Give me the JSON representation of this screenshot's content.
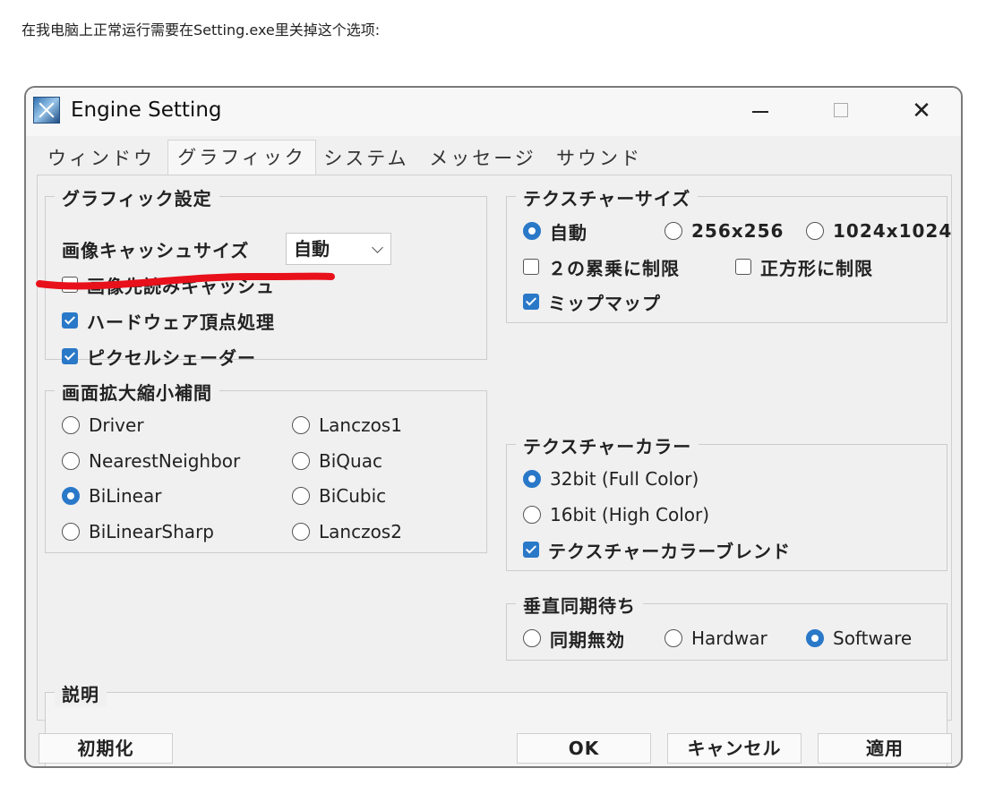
{
  "caption": "在我电脑上正常运行需要在Setting.exe里关掉这个选项:",
  "window": {
    "title": "Engine Setting",
    "icon": "engine-app-icon",
    "controls": {
      "minimize": "minimize-icon",
      "maximize": "maximize-icon",
      "close": "✕"
    }
  },
  "tabs": [
    {
      "label": "ウィンドウ",
      "active": false
    },
    {
      "label": "グラフィック",
      "active": true
    },
    {
      "label": "システム",
      "active": false
    },
    {
      "label": "メッセージ",
      "active": false
    },
    {
      "label": "サウンド",
      "active": false
    }
  ],
  "graphic_settings": {
    "title": "グラフィック設定",
    "cache_size_label": "画像キャッシュサイズ",
    "cache_size_value": "自動",
    "checkboxes": [
      {
        "label": "画像先読みキャッシュ",
        "checked": false
      },
      {
        "label": "ハードウェア頂点処理",
        "checked": true
      },
      {
        "label": "ピクセルシェーダー",
        "checked": true
      }
    ]
  },
  "scaling": {
    "title": "画面拡大縮小補間",
    "options": [
      {
        "label": "Driver",
        "selected": false
      },
      {
        "label": "Lanczos1",
        "selected": false
      },
      {
        "label": "NearestNeighbor",
        "selected": false
      },
      {
        "label": "BiQuac",
        "selected": false
      },
      {
        "label": "BiLinear",
        "selected": true
      },
      {
        "label": "BiCubic",
        "selected": false
      },
      {
        "label": "BiLinearSharp",
        "selected": false
      },
      {
        "label": "Lanczos2",
        "selected": false
      }
    ]
  },
  "texture_size": {
    "title": "テクスチャーサイズ",
    "options": [
      {
        "label": "自動",
        "selected": true
      },
      {
        "label": "256x256",
        "selected": false
      },
      {
        "label": "1024x1024",
        "selected": false
      }
    ],
    "checkboxes": [
      {
        "label": "２の累乗に制限",
        "checked": false
      },
      {
        "label": "正方形に制限",
        "checked": false
      },
      {
        "label": "ミップマップ",
        "checked": true
      }
    ]
  },
  "texture_color": {
    "title": "テクスチャーカラー",
    "options": [
      {
        "label": "32bit (Full Color)",
        "selected": true
      },
      {
        "label": "16bit (High Color)",
        "selected": false
      }
    ],
    "checkbox": {
      "label": "テクスチャーカラーブレンド",
      "checked": true
    }
  },
  "vsync": {
    "title": "垂直同期待ち",
    "options": [
      {
        "label": "同期無効",
        "selected": false
      },
      {
        "label": "Hardwar",
        "selected": false
      },
      {
        "label": "Software",
        "selected": true
      }
    ]
  },
  "description": {
    "title": "説明",
    "text": ""
  },
  "buttons": {
    "reset": "初期化",
    "ok": "OK",
    "cancel": "キャンセル",
    "apply": "適用"
  },
  "colors": {
    "accent": "#2a78c8",
    "annotation": "#e8101a",
    "window_bg": "#f0f0f0"
  }
}
